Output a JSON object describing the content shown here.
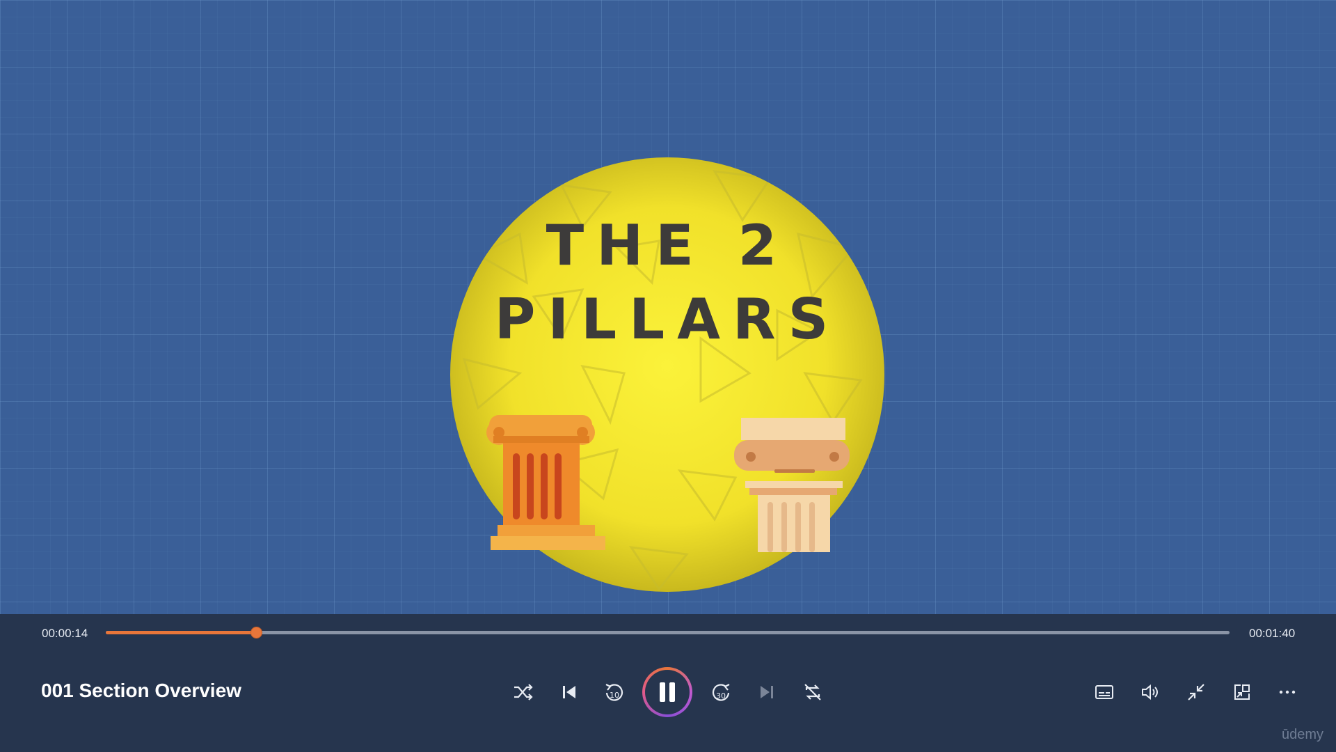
{
  "video": {
    "title_line1": "THE 2",
    "title_line2": "PILLARS",
    "circle_color": "#f5e62a",
    "background_color": "#3a5f98",
    "watermark": "ūdemy"
  },
  "player": {
    "current_time": "00:00:14",
    "duration": "00:01:40",
    "progress_fraction": 0.134,
    "lecture_title": "001 Section Overview",
    "accent_color": "#e8763a",
    "buttons": [
      {
        "name": "shuffle-button",
        "icon": "shuffle-icon"
      },
      {
        "name": "previous-button",
        "icon": "skip-previous-icon"
      },
      {
        "name": "rewind-10-button",
        "icon": "rewind-10-icon",
        "label": "10"
      },
      {
        "name": "pause-button",
        "icon": "pause-icon"
      },
      {
        "name": "forward-30-button",
        "icon": "forward-30-icon",
        "label": "30"
      },
      {
        "name": "next-button",
        "icon": "skip-next-icon"
      },
      {
        "name": "repeat-button",
        "icon": "repeat-off-icon"
      },
      {
        "name": "captions-button",
        "icon": "captions-icon"
      },
      {
        "name": "volume-button",
        "icon": "volume-icon"
      },
      {
        "name": "exit-fullscreen-button",
        "icon": "minimize-icon"
      },
      {
        "name": "mini-player-button",
        "icon": "mini-player-icon"
      },
      {
        "name": "more-button",
        "icon": "more-icon"
      }
    ]
  }
}
